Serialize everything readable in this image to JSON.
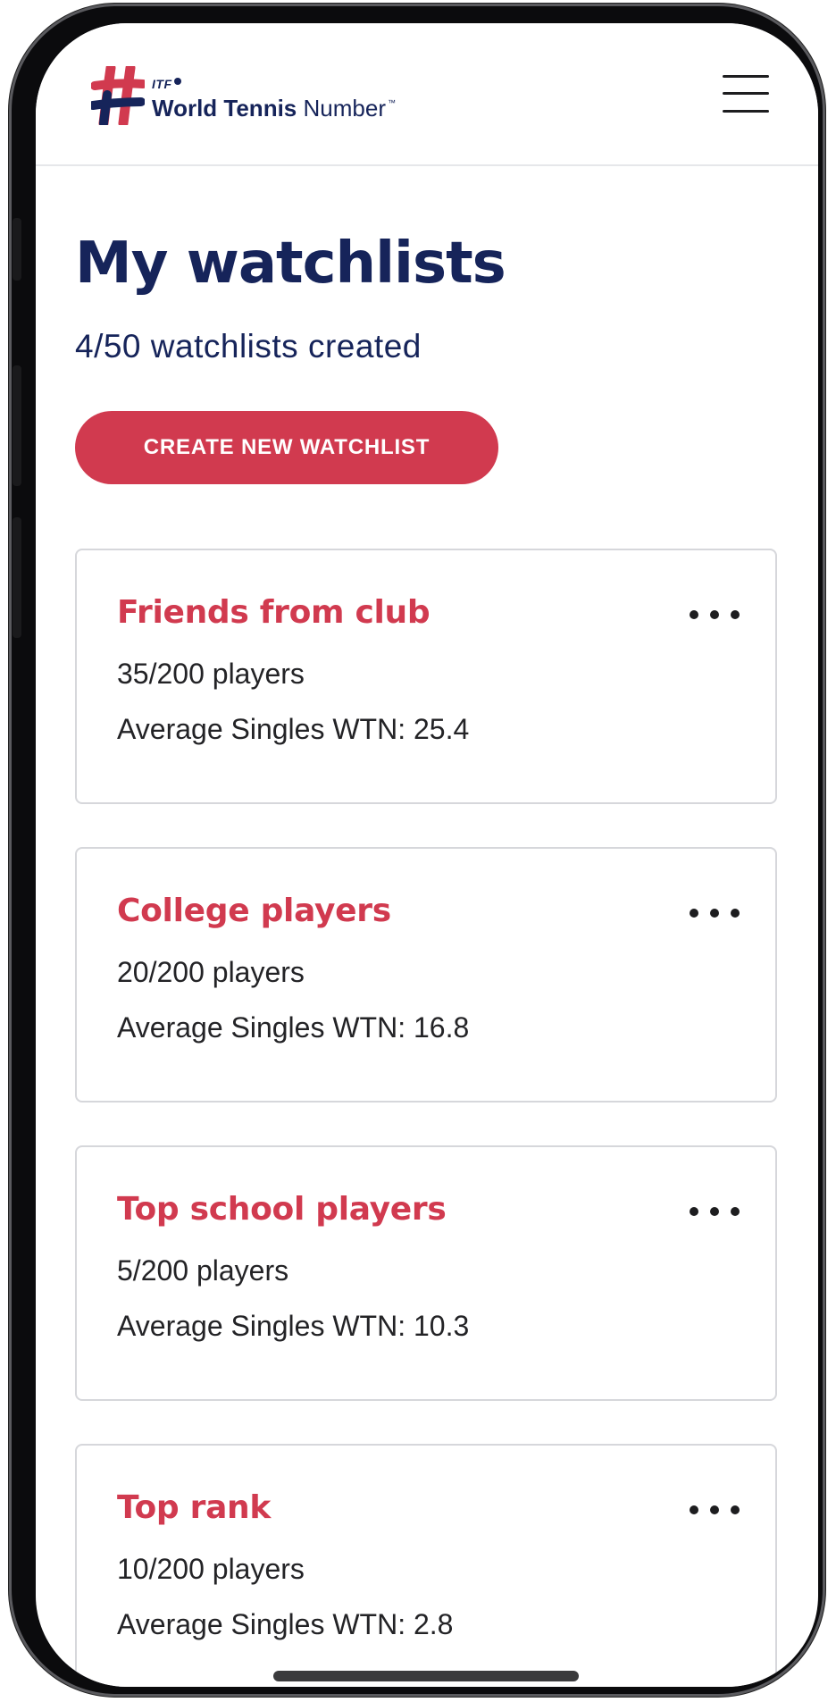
{
  "header": {
    "logo_org": "ITF",
    "logo_brand_bold": "World Tennis",
    "logo_brand_light": "Number",
    "logo_tm": "™",
    "brand_colors": {
      "navy": "#16245a",
      "red": "#d13a4f"
    },
    "menu_icon": "hamburger-menu-icon"
  },
  "main": {
    "title": "My watchlists",
    "count_text": "4/50 watchlists created",
    "create_button_label": "CREATE NEW WATCHLIST",
    "watchlists": [
      {
        "name": "Friends from club",
        "players": "35/200 players",
        "avg_wtn": "Average Singles WTN: 25.4"
      },
      {
        "name": "College players",
        "players": "20/200 players",
        "avg_wtn": "Average Singles WTN: 16.8"
      },
      {
        "name": "Top school players",
        "players": "5/200 players",
        "avg_wtn": "Average Singles WTN: 10.3"
      },
      {
        "name": "Top rank",
        "players": "10/200 players",
        "avg_wtn": "Average Singles WTN: 2.8"
      }
    ],
    "more_icon": "more-options-icon"
  },
  "colors": {
    "accent": "#d13a4f",
    "title": "#16245a",
    "body_text": "#232326",
    "card_border": "#d6d7db"
  }
}
